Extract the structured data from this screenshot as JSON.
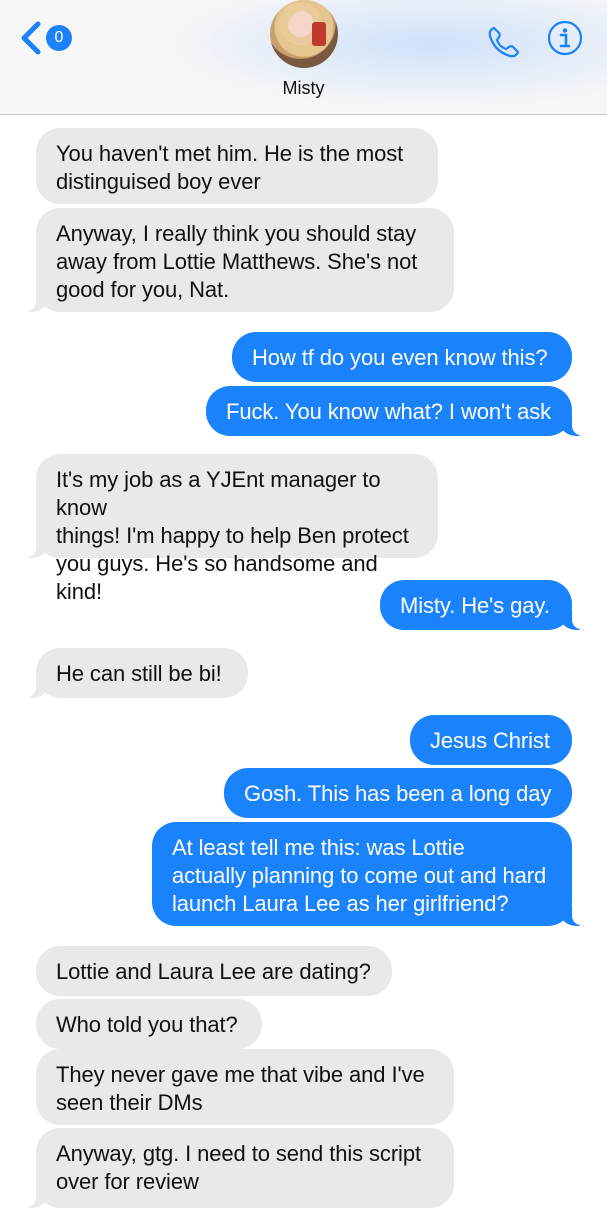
{
  "header": {
    "back_badge": "0",
    "contact_name": "Misty",
    "icons": {
      "back": "chevron-left-icon",
      "phone": "phone-icon",
      "info": "info-icon"
    },
    "accent_color": "#1a82fb"
  },
  "messages": [
    {
      "sender": "contact",
      "text": "You haven't met him. He is the most\ndistinguised boy ever"
    },
    {
      "sender": "contact",
      "text": "Anyway, I really think you should stay\naway from Lottie Matthews. She's not\ngood for you, Nat."
    },
    {
      "sender": "me",
      "text": "How tf do you even know this?"
    },
    {
      "sender": "me",
      "text": "Fuck. You know what? I won't ask"
    },
    {
      "sender": "contact",
      "text": "It's my job as a YJEnt manager to know\nthings! I'm happy to help Ben protect\nyou guys. He's so handsome and kind!"
    },
    {
      "sender": "me",
      "text": "Misty. He's gay."
    },
    {
      "sender": "contact",
      "text": "He can still be bi!"
    },
    {
      "sender": "me",
      "text": "Jesus Christ"
    },
    {
      "sender": "me",
      "text": "Gosh. This has been a long day"
    },
    {
      "sender": "me",
      "text": "At least tell me this: was Lottie\nactually planning to come out and hard\nlaunch Laura Lee as her girlfriend?"
    },
    {
      "sender": "contact",
      "text": "Lottie and Laura Lee are dating?"
    },
    {
      "sender": "contact",
      "text": "Who told you that?"
    },
    {
      "sender": "contact",
      "text": "They never gave me that vibe and I've\nseen their DMs"
    },
    {
      "sender": "contact",
      "text": "Anyway, gtg. I need to send this script\nover for review"
    }
  ]
}
